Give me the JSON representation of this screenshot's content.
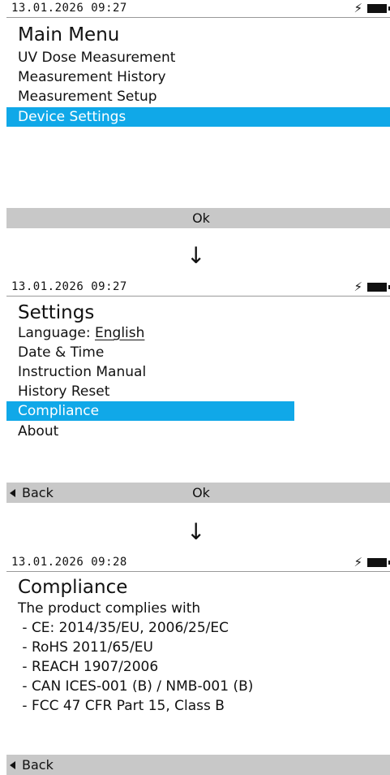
{
  "screens": [
    {
      "time": "13.01.2026 09:27",
      "title": "Main Menu",
      "items": [
        "UV Dose Measurement",
        "Measurement History",
        "Measurement Setup",
        "Device Settings"
      ],
      "ok_label": "Ok"
    },
    {
      "time": "13.01.2026 09:27",
      "title": "Settings",
      "language_label": "Language: ",
      "language_value": "English",
      "items": [
        "Date & Time",
        "Instruction Manual",
        "History Reset",
        "Compliance",
        "About"
      ],
      "back_label": "Back",
      "ok_label": "Ok"
    },
    {
      "time": "13.01.2026 09:28",
      "title": "Compliance",
      "lines": [
        "The product complies with",
        " - CE: 2014/35/EU, 2006/25/EC",
        " - RoHS 2011/65/EU",
        " - REACH 1907/2006",
        " - CAN ICES-001 (B) / NMB-001 (B)",
        " - FCC 47 CFR Part 15, Class B"
      ],
      "back_label": "Back"
    }
  ],
  "flow_arrow": "↓",
  "icons": {
    "charging": "charging-bolt-icon",
    "battery": "battery-icon"
  },
  "colors": {
    "selection": "#10a8e8",
    "button_bar": "#c8c8c8"
  }
}
